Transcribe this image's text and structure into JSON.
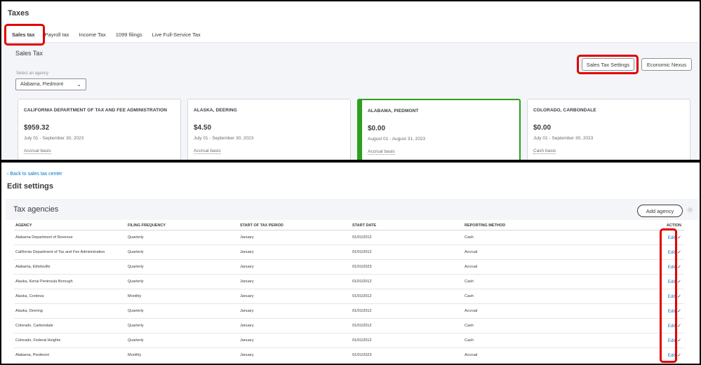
{
  "header": {
    "title": "Taxes"
  },
  "tabs": [
    {
      "label": "Sales tax",
      "active": true
    },
    {
      "label": "Payroll tax",
      "active": false
    },
    {
      "label": "Income Tax",
      "active": false
    },
    {
      "label": "1099 filings",
      "active": false
    },
    {
      "label": "Live Full-Service Tax",
      "active": false
    }
  ],
  "sales_tax": {
    "title": "Sales Tax",
    "agency_label": "Select an agency",
    "agency_value": "Alabama, Piedmont",
    "settings_button": "Sales Tax Settings",
    "nexus_button": "Economic Nexus",
    "cards": [
      {
        "name": "CALIFORNIA DEPARTMENT OF TAX AND FEE ADMINISTRATION",
        "amount": "$959.32",
        "period": "July 01 - September 30, 2023",
        "basis": "Accrual basis"
      },
      {
        "name": "ALASKA, DEERING",
        "amount": "$4.50",
        "period": "July 01 - September 30, 2023",
        "basis": "Accrual basis"
      },
      {
        "name": "ALABAMA, PIEDMONT",
        "amount": "$0.00",
        "period": "August 01 - August 31, 2023",
        "basis": "Accrual basis"
      },
      {
        "name": "COLORADO, CARBONDALE",
        "amount": "$0.00",
        "period": "July 01 - September 30, 2023",
        "basis": "Cash basis"
      }
    ]
  },
  "settings": {
    "back_link": "Back to sales tax center",
    "title": "Edit settings",
    "agencies_title": "Tax agencies",
    "add_agency": "Add agency",
    "columns": [
      "AGENCY",
      "FILING FREQUENCY",
      "START OF TAX PERIOD",
      "START DATE",
      "REPORTING METHOD",
      "ACTION"
    ],
    "edit_label": "Edit",
    "rows": [
      [
        "Alabama Department of Revenue",
        "Quarterly",
        "January",
        "01/01/2012",
        "Cash"
      ],
      [
        "California Department of Tax and Fee Administration",
        "Quarterly",
        "January",
        "01/01/2012",
        "Accrual"
      ],
      [
        "Alabama, Ethelsville",
        "Quarterly",
        "January",
        "01/01/2023",
        "Accrual"
      ],
      [
        "Alaska, Kenai Peninsula Borough",
        "Quarterly",
        "January",
        "01/01/2012",
        "Cash"
      ],
      [
        "Alaska, Cordova",
        "Monthly",
        "January",
        "01/01/2012",
        "Cash"
      ],
      [
        "Alaska, Deering",
        "Quarterly",
        "January",
        "01/01/2012",
        "Accrual"
      ],
      [
        "Colorado, Carbondale",
        "Quarterly",
        "January",
        "01/01/2012",
        "Cash"
      ],
      [
        "Colorado, Federal Heights",
        "Quarterly",
        "January",
        "01/01/2012",
        "Cash"
      ],
      [
        "Alabama, Piedmont",
        "Monthly",
        "January",
        "01/01/2023",
        "Accrual"
      ]
    ]
  },
  "colors": {
    "accent_green": "#2ca01c",
    "link_blue": "#0077c5",
    "highlight_red": "#e00000"
  }
}
